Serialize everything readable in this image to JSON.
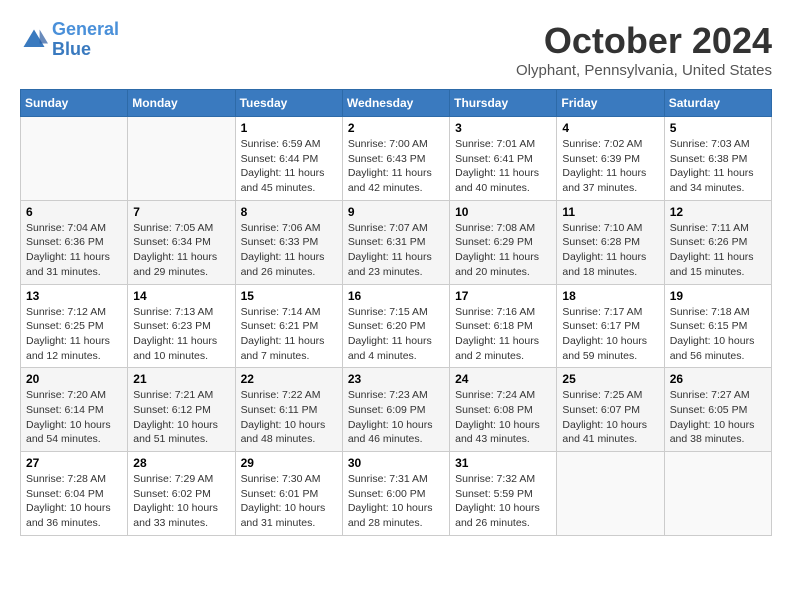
{
  "header": {
    "logo_line1": "General",
    "logo_line2": "Blue",
    "month": "October 2024",
    "location": "Olyphant, Pennsylvania, United States"
  },
  "days_of_week": [
    "Sunday",
    "Monday",
    "Tuesday",
    "Wednesday",
    "Thursday",
    "Friday",
    "Saturday"
  ],
  "weeks": [
    [
      {
        "day": "",
        "info": ""
      },
      {
        "day": "",
        "info": ""
      },
      {
        "day": "1",
        "info": "Sunrise: 6:59 AM\nSunset: 6:44 PM\nDaylight: 11 hours and 45 minutes."
      },
      {
        "day": "2",
        "info": "Sunrise: 7:00 AM\nSunset: 6:43 PM\nDaylight: 11 hours and 42 minutes."
      },
      {
        "day": "3",
        "info": "Sunrise: 7:01 AM\nSunset: 6:41 PM\nDaylight: 11 hours and 40 minutes."
      },
      {
        "day": "4",
        "info": "Sunrise: 7:02 AM\nSunset: 6:39 PM\nDaylight: 11 hours and 37 minutes."
      },
      {
        "day": "5",
        "info": "Sunrise: 7:03 AM\nSunset: 6:38 PM\nDaylight: 11 hours and 34 minutes."
      }
    ],
    [
      {
        "day": "6",
        "info": "Sunrise: 7:04 AM\nSunset: 6:36 PM\nDaylight: 11 hours and 31 minutes."
      },
      {
        "day": "7",
        "info": "Sunrise: 7:05 AM\nSunset: 6:34 PM\nDaylight: 11 hours and 29 minutes."
      },
      {
        "day": "8",
        "info": "Sunrise: 7:06 AM\nSunset: 6:33 PM\nDaylight: 11 hours and 26 minutes."
      },
      {
        "day": "9",
        "info": "Sunrise: 7:07 AM\nSunset: 6:31 PM\nDaylight: 11 hours and 23 minutes."
      },
      {
        "day": "10",
        "info": "Sunrise: 7:08 AM\nSunset: 6:29 PM\nDaylight: 11 hours and 20 minutes."
      },
      {
        "day": "11",
        "info": "Sunrise: 7:10 AM\nSunset: 6:28 PM\nDaylight: 11 hours and 18 minutes."
      },
      {
        "day": "12",
        "info": "Sunrise: 7:11 AM\nSunset: 6:26 PM\nDaylight: 11 hours and 15 minutes."
      }
    ],
    [
      {
        "day": "13",
        "info": "Sunrise: 7:12 AM\nSunset: 6:25 PM\nDaylight: 11 hours and 12 minutes."
      },
      {
        "day": "14",
        "info": "Sunrise: 7:13 AM\nSunset: 6:23 PM\nDaylight: 11 hours and 10 minutes."
      },
      {
        "day": "15",
        "info": "Sunrise: 7:14 AM\nSunset: 6:21 PM\nDaylight: 11 hours and 7 minutes."
      },
      {
        "day": "16",
        "info": "Sunrise: 7:15 AM\nSunset: 6:20 PM\nDaylight: 11 hours and 4 minutes."
      },
      {
        "day": "17",
        "info": "Sunrise: 7:16 AM\nSunset: 6:18 PM\nDaylight: 11 hours and 2 minutes."
      },
      {
        "day": "18",
        "info": "Sunrise: 7:17 AM\nSunset: 6:17 PM\nDaylight: 10 hours and 59 minutes."
      },
      {
        "day": "19",
        "info": "Sunrise: 7:18 AM\nSunset: 6:15 PM\nDaylight: 10 hours and 56 minutes."
      }
    ],
    [
      {
        "day": "20",
        "info": "Sunrise: 7:20 AM\nSunset: 6:14 PM\nDaylight: 10 hours and 54 minutes."
      },
      {
        "day": "21",
        "info": "Sunrise: 7:21 AM\nSunset: 6:12 PM\nDaylight: 10 hours and 51 minutes."
      },
      {
        "day": "22",
        "info": "Sunrise: 7:22 AM\nSunset: 6:11 PM\nDaylight: 10 hours and 48 minutes."
      },
      {
        "day": "23",
        "info": "Sunrise: 7:23 AM\nSunset: 6:09 PM\nDaylight: 10 hours and 46 minutes."
      },
      {
        "day": "24",
        "info": "Sunrise: 7:24 AM\nSunset: 6:08 PM\nDaylight: 10 hours and 43 minutes."
      },
      {
        "day": "25",
        "info": "Sunrise: 7:25 AM\nSunset: 6:07 PM\nDaylight: 10 hours and 41 minutes."
      },
      {
        "day": "26",
        "info": "Sunrise: 7:27 AM\nSunset: 6:05 PM\nDaylight: 10 hours and 38 minutes."
      }
    ],
    [
      {
        "day": "27",
        "info": "Sunrise: 7:28 AM\nSunset: 6:04 PM\nDaylight: 10 hours and 36 minutes."
      },
      {
        "day": "28",
        "info": "Sunrise: 7:29 AM\nSunset: 6:02 PM\nDaylight: 10 hours and 33 minutes."
      },
      {
        "day": "29",
        "info": "Sunrise: 7:30 AM\nSunset: 6:01 PM\nDaylight: 10 hours and 31 minutes."
      },
      {
        "day": "30",
        "info": "Sunrise: 7:31 AM\nSunset: 6:00 PM\nDaylight: 10 hours and 28 minutes."
      },
      {
        "day": "31",
        "info": "Sunrise: 7:32 AM\nSunset: 5:59 PM\nDaylight: 10 hours and 26 minutes."
      },
      {
        "day": "",
        "info": ""
      },
      {
        "day": "",
        "info": ""
      }
    ]
  ]
}
